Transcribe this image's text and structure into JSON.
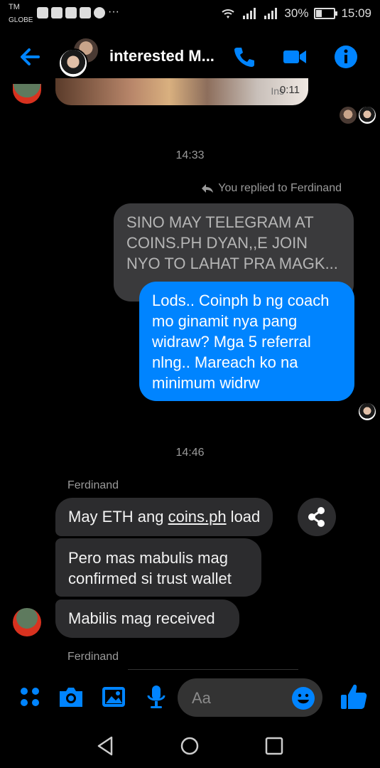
{
  "status_bar": {
    "carrier_top": "TM",
    "carrier_bottom": "GLOBE",
    "battery": "30%",
    "time": "15:09"
  },
  "header": {
    "title": "interested M...",
    "icons": [
      "back-arrow-icon",
      "phone-icon",
      "video-camera-icon",
      "info-icon"
    ]
  },
  "video_preview": {
    "duration": "0:11",
    "watermark": "Ins"
  },
  "messages": {
    "time_1": "14:33",
    "reply_label": "You replied to Ferdinand",
    "quoted_text": "SINO MAY TELEGRAM AT COINS.PH DYAN,,E JOIN NYO TO LAHAT PRA MAGK...",
    "outgoing_text": "Lods.. Coinph b ng coach mo ginamit nya pang widraw? Mga 5 referral nlng.. Mareach ko na minimum widrw",
    "time_2": "14:46",
    "sender_name": "Ferdinand",
    "msg1_prefix": "May ETH ang ",
    "msg1_link": "coins.ph",
    "msg1_suffix": " load",
    "msg2": "Pero mas mabulis mag confirmed si trust wallet",
    "msg3": "Mabilis mag received",
    "sender_name_2": "Ferdinand"
  },
  "composer": {
    "placeholder": "Aa",
    "icons": [
      "menu-dots-icon",
      "camera-icon",
      "gallery-icon",
      "microphone-icon",
      "emoji-icon",
      "thumbs-up-icon"
    ]
  },
  "colors": {
    "accent": "#0084ff",
    "incoming_bubble": "#2c2c2e",
    "background": "#000000"
  }
}
